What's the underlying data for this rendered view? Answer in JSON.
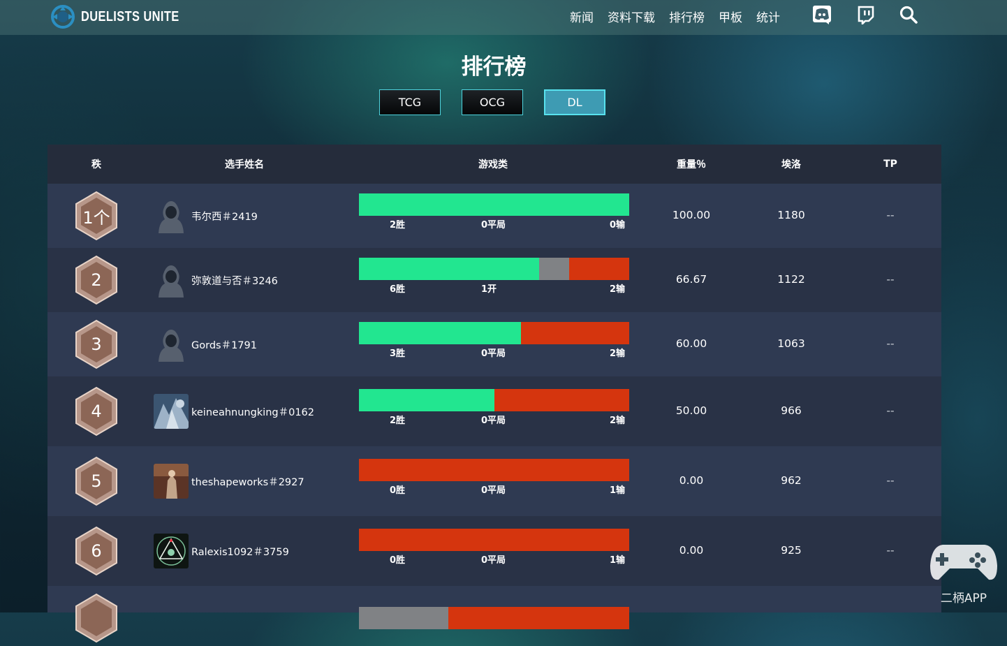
{
  "header": {
    "logo_text": "DUELISTS UNITE",
    "nav": [
      "新闻",
      "资料下载",
      "排行榜",
      "甲板",
      "统计"
    ],
    "icons": [
      "discord-icon",
      "twitch-icon",
      "search-icon"
    ]
  },
  "page": {
    "title": "排行榜",
    "tabs": [
      "TCG",
      "OCG",
      "DL"
    ],
    "active_tab": "DL"
  },
  "table": {
    "columns": [
      "秩",
      "选手姓名",
      "游戏类",
      "重量％",
      "埃洛",
      "TP"
    ],
    "rows": [
      {
        "rank": "1个",
        "player": "韦尔西＃2419",
        "avatar": "default",
        "wins": 2,
        "draws": 0,
        "losses": 0,
        "win_label": "2胜",
        "draw_label": "0平局",
        "loss_label": "0输",
        "weight": "100.00",
        "elo": "1180",
        "tp": "--"
      },
      {
        "rank": "2",
        "player": "弥敦道与否＃3246",
        "avatar": "default",
        "wins": 6,
        "draws": 1,
        "losses": 2,
        "win_label": "6胜",
        "draw_label": "1开",
        "loss_label": "2输",
        "weight": "66.67",
        "elo": "1122",
        "tp": "--"
      },
      {
        "rank": "3",
        "player": "Gords＃1791",
        "avatar": "default",
        "wins": 3,
        "draws": 0,
        "losses": 2,
        "win_label": "3胜",
        "draw_label": "0平局",
        "loss_label": "2输",
        "weight": "60.00",
        "elo": "1063",
        "tp": "--"
      },
      {
        "rank": "4",
        "player": "keineahnungking＃0162",
        "avatar": "image-blue",
        "wins": 2,
        "draws": 0,
        "losses": 2,
        "win_label": "2胜",
        "draw_label": "0平局",
        "loss_label": "2输",
        "weight": "50.00",
        "elo": "966",
        "tp": "--"
      },
      {
        "rank": "5",
        "player": "theshapeworks＃2927",
        "avatar": "image-brown",
        "wins": 0,
        "draws": 0,
        "losses": 1,
        "win_label": "0胜",
        "draw_label": "0平局",
        "loss_label": "1输",
        "weight": "0.00",
        "elo": "962",
        "tp": "--"
      },
      {
        "rank": "6",
        "player": "Ralexis1092＃3759",
        "avatar": "image-emblem",
        "wins": 0,
        "draws": 0,
        "losses": 1,
        "win_label": "0胜",
        "draw_label": "0平局",
        "loss_label": "1输",
        "weight": "0.00",
        "elo": "925",
        "tp": "--"
      }
    ]
  },
  "watermark": {
    "text": "二柄APP"
  },
  "colors": {
    "win": "#22e690",
    "draw": "#808285",
    "loss": "#d5350e",
    "tab_border": "#4fd5df",
    "tab_active": "#3e9bb3"
  }
}
